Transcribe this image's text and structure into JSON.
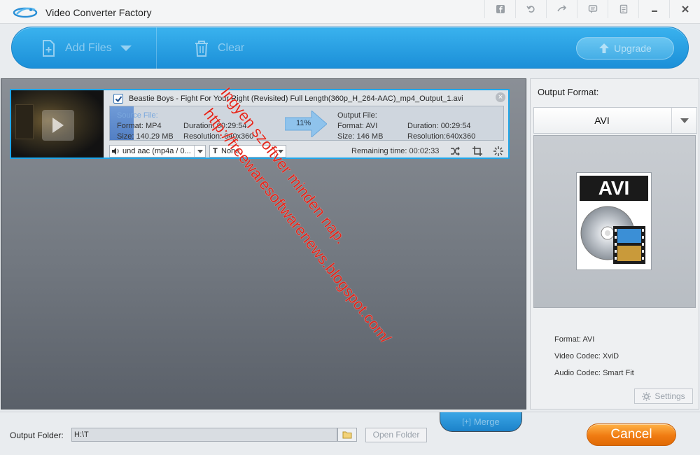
{
  "app": {
    "title": "Video Converter Factory"
  },
  "toolbar": {
    "add_files_label": "Add Files",
    "clear_label": "Clear",
    "upgrade_label": "Upgrade"
  },
  "file_item": {
    "name": "Beastie Boys - Fight For Your Right (Revisited) Full Length(360p_H_264-AAC)_mp4_Output_1.avi",
    "checked": true,
    "progress_percent": 11,
    "progress_text": "11%",
    "source": {
      "heading": "Source File:",
      "format": "Format: MP4",
      "size": "Size: 140.29 MB",
      "duration": "Duration: 00:29:54",
      "resolution": "Resolution: 640x360"
    },
    "output": {
      "heading": "Output File:",
      "format": "Format: AVI",
      "size": "Size: 146 MB",
      "duration": "Duration: 00:29:54",
      "resolution": "Resolution:640x360"
    },
    "audio_track": "und aac (mp4a / 0...",
    "subtitle": "None",
    "remaining": "Remaining time: 00:02:33"
  },
  "watermark": {
    "line1": "Ingyen szoftver minden nap.",
    "line2": "http://freewaresoftwarenews.blogspot.com/",
    "color": "#e3261b"
  },
  "side_panel": {
    "output_format_label": "Output Format:",
    "selected_format": "AVI",
    "format_badge": "AVI",
    "specs": {
      "format": "Format: AVI",
      "video_codec": "Video Codec: XviD",
      "audio_codec": "Audio Codec: Smart Fit"
    },
    "settings_label": "Settings"
  },
  "bottom": {
    "merge_label": "Merge",
    "output_folder_label": "Output Folder:",
    "output_folder_value": "H:\\T",
    "open_folder_label": "Open Folder",
    "cancel_label": "Cancel"
  },
  "colors": {
    "accent": "#1b8fd8",
    "cancel": "#f07b12",
    "selection_border": "#1ea6ea"
  }
}
